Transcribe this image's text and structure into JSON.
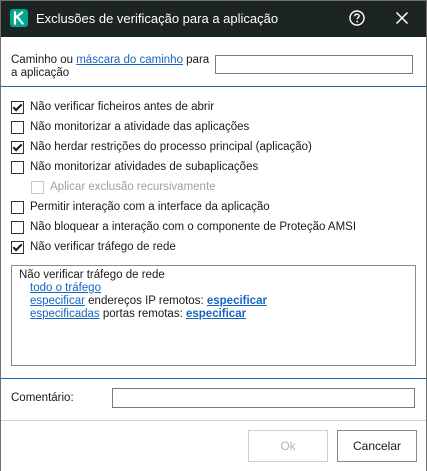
{
  "window": {
    "title": "Exclusões de verificação para a aplicação",
    "help_icon": "help-circle-icon",
    "close_icon": "close-icon",
    "logo_icon": "kaspersky-k-logo",
    "accent_color": "#00a88e",
    "titlebar_color": "#1d2424"
  },
  "path": {
    "label_before": "Caminho ou ",
    "label_link": "máscara do caminho",
    "label_after": " para a aplicação",
    "value": ""
  },
  "options": [
    {
      "label": "Não verificar ficheiros antes de abrir",
      "checked": true,
      "enabled": true
    },
    {
      "label": "Não monitorizar a atividade das aplicações",
      "checked": false,
      "enabled": true
    },
    {
      "label": "Não herdar restrições do processo principal (aplicação)",
      "checked": true,
      "enabled": true
    },
    {
      "label": "Não monitorizar atividades de subaplicações",
      "checked": false,
      "enabled": true
    },
    {
      "label": "Aplicar exclusão recursivamente",
      "checked": false,
      "enabled": false
    },
    {
      "label": "Permitir interação com a interface da aplicação",
      "checked": false,
      "enabled": true
    },
    {
      "label": "Não bloquear a interação com o componente de Proteção AMSI",
      "checked": false,
      "enabled": true
    },
    {
      "label": "Não verificar tráfego de rede",
      "checked": true,
      "enabled": true
    }
  ],
  "details": {
    "heading": "Não verificar tráfego de rede",
    "all_traffic_link": "todo o tráfego",
    "ip_link": "especificar",
    "ip_text": " endereços IP remotos: ",
    "ip_value_link": "especificar",
    "ports_link": "especificadas",
    "ports_text": " portas remotas: ",
    "ports_value_link": "especificar"
  },
  "comment": {
    "label": "Comentário:",
    "value": ""
  },
  "buttons": {
    "ok": "Ok",
    "ok_enabled": false,
    "cancel": "Cancelar"
  }
}
